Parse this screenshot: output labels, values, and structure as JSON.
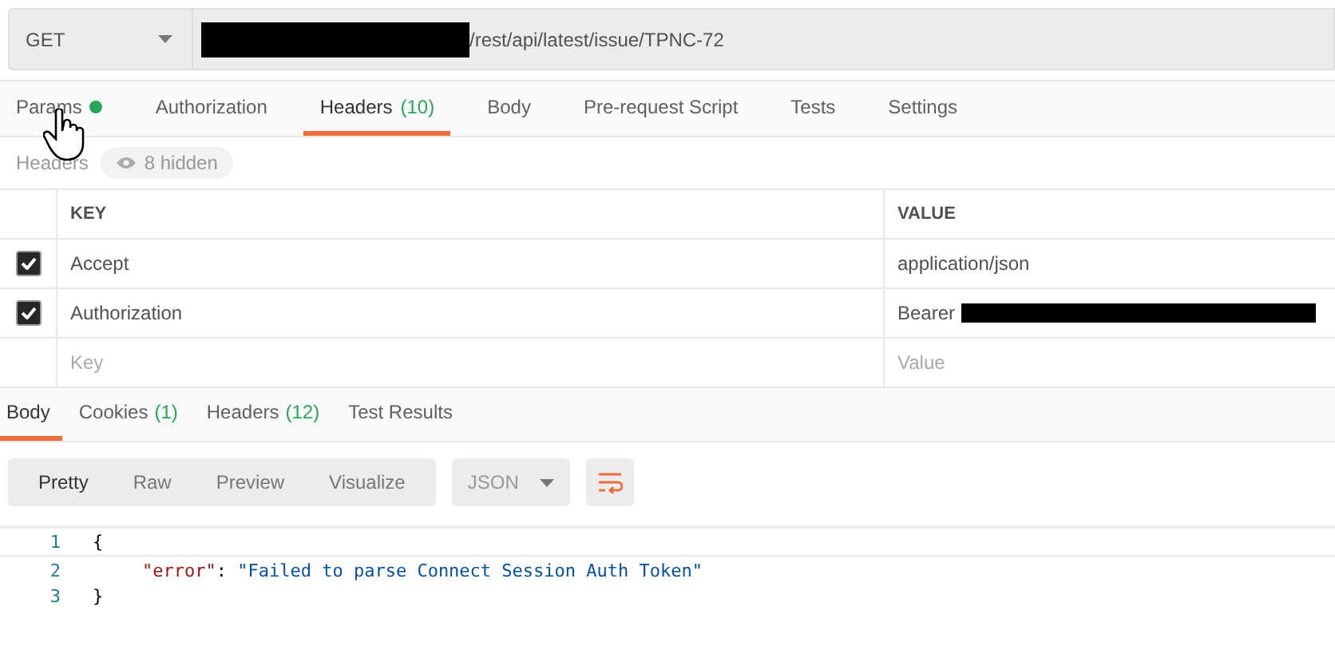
{
  "request": {
    "method": "GET",
    "url": "/rest/api/latest/issue/TPNC-72",
    "url_redacted": true
  },
  "tabs": [
    {
      "label": "Params",
      "dot": true,
      "selected": false
    },
    {
      "label": "Authorization",
      "selected": false
    },
    {
      "label": "Headers",
      "count": "(10)",
      "selected": true
    },
    {
      "label": "Body",
      "selected": false
    },
    {
      "label": "Pre-request Script",
      "selected": false
    },
    {
      "label": "Tests",
      "selected": false
    },
    {
      "label": "Settings",
      "selected": false
    }
  ],
  "headers_bar": {
    "label": "Headers",
    "hidden": "8 hidden"
  },
  "table": {
    "columns": [
      "KEY",
      "VALUE"
    ],
    "rows": [
      {
        "key": "Accept",
        "value": "application/json",
        "checked": true
      },
      {
        "key": "Authorization",
        "value": "Bearer",
        "value_redacted": true,
        "checked": true
      }
    ],
    "placeholder_key": "Key",
    "placeholder_value": "Value"
  },
  "response_tabs": [
    {
      "label": "Body",
      "selected": true
    },
    {
      "label": "Cookies",
      "count": "(1)",
      "selected": false
    },
    {
      "label": "Headers",
      "count": "(12)",
      "selected": false
    },
    {
      "label": "Test Results",
      "selected": false
    }
  ],
  "view_modes": [
    {
      "label": "Pretty",
      "selected": true
    },
    {
      "label": "Raw",
      "selected": false
    },
    {
      "label": "Preview",
      "selected": false
    },
    {
      "label": "Visualize",
      "selected": false
    }
  ],
  "format": "JSON",
  "code": [
    {
      "number": "1",
      "tokens": [
        {
          "kind": "punct",
          "text": "{"
        }
      ]
    },
    {
      "number": "2",
      "indented": true,
      "tokens": [
        {
          "kind": "key",
          "text": "\"error\""
        },
        {
          "kind": "punct",
          "text": ": "
        },
        {
          "kind": "string",
          "text": "\"Failed to parse Connect Session Auth Token\""
        }
      ]
    },
    {
      "number": "3",
      "tokens": [
        {
          "kind": "punct",
          "text": "}"
        }
      ]
    }
  ]
}
